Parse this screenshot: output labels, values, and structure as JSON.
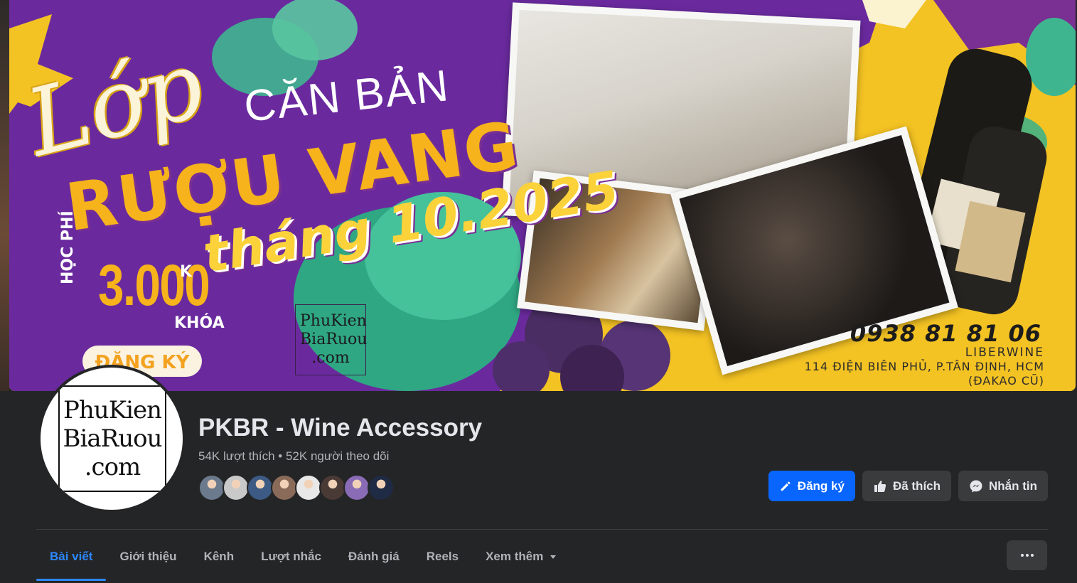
{
  "cover": {
    "title_script": "Lớp",
    "title_line1": "CĂN BẢN",
    "title_line2": "RƯỢU VANG",
    "title_line3": "tháng 10.2025",
    "fee_label": "HỌC PHÍ",
    "fee_value": "3.000",
    "fee_unit": "K",
    "fee_suffix": "KHÓA",
    "register_label": "ĐĂNG KÝ",
    "logo_line1": "PhuKien",
    "logo_line2": "BiaRuou",
    "logo_line3": ".com",
    "phone": "0938 81 81 06",
    "brand": "LIBERWINE",
    "address": "114 ĐIỆN BIÊN PHỦ, P.TÂN ĐỊNH, HCM",
    "address_note": "(ĐAKAO CŨ)"
  },
  "profile": {
    "avatar_line1": "PhuKien",
    "avatar_line2": "BiaRuou",
    "avatar_line3": ".com",
    "page_name": "PKBR - Wine Accessory",
    "stats": "54K lượt thích • 52K người theo dõi",
    "follower_avatars": [
      "#6b7a8c",
      "#c9c9c9",
      "#3c5a84",
      "#8a6b5a",
      "#e8e8e8",
      "#4a3a35",
      "#8a6bb5",
      "#1f2a44"
    ]
  },
  "actions": {
    "primary_label": "Đăng ký",
    "liked_label": "Đã thích",
    "message_label": "Nhắn tin"
  },
  "tabs": [
    {
      "label": "Bài viết",
      "active": true
    },
    {
      "label": "Giới thiệu",
      "active": false
    },
    {
      "label": "Kênh",
      "active": false
    },
    {
      "label": "Lượt nhắc",
      "active": false
    },
    {
      "label": "Đánh giá",
      "active": false
    },
    {
      "label": "Reels",
      "active": false
    },
    {
      "label": "Xem thêm",
      "active": false
    }
  ],
  "colors": {
    "background": "#242526",
    "primary": "#0866ff",
    "active_tab": "#2d88ff",
    "cover_purple": "#6a2a9e",
    "cover_yellow": "#f3c223"
  }
}
